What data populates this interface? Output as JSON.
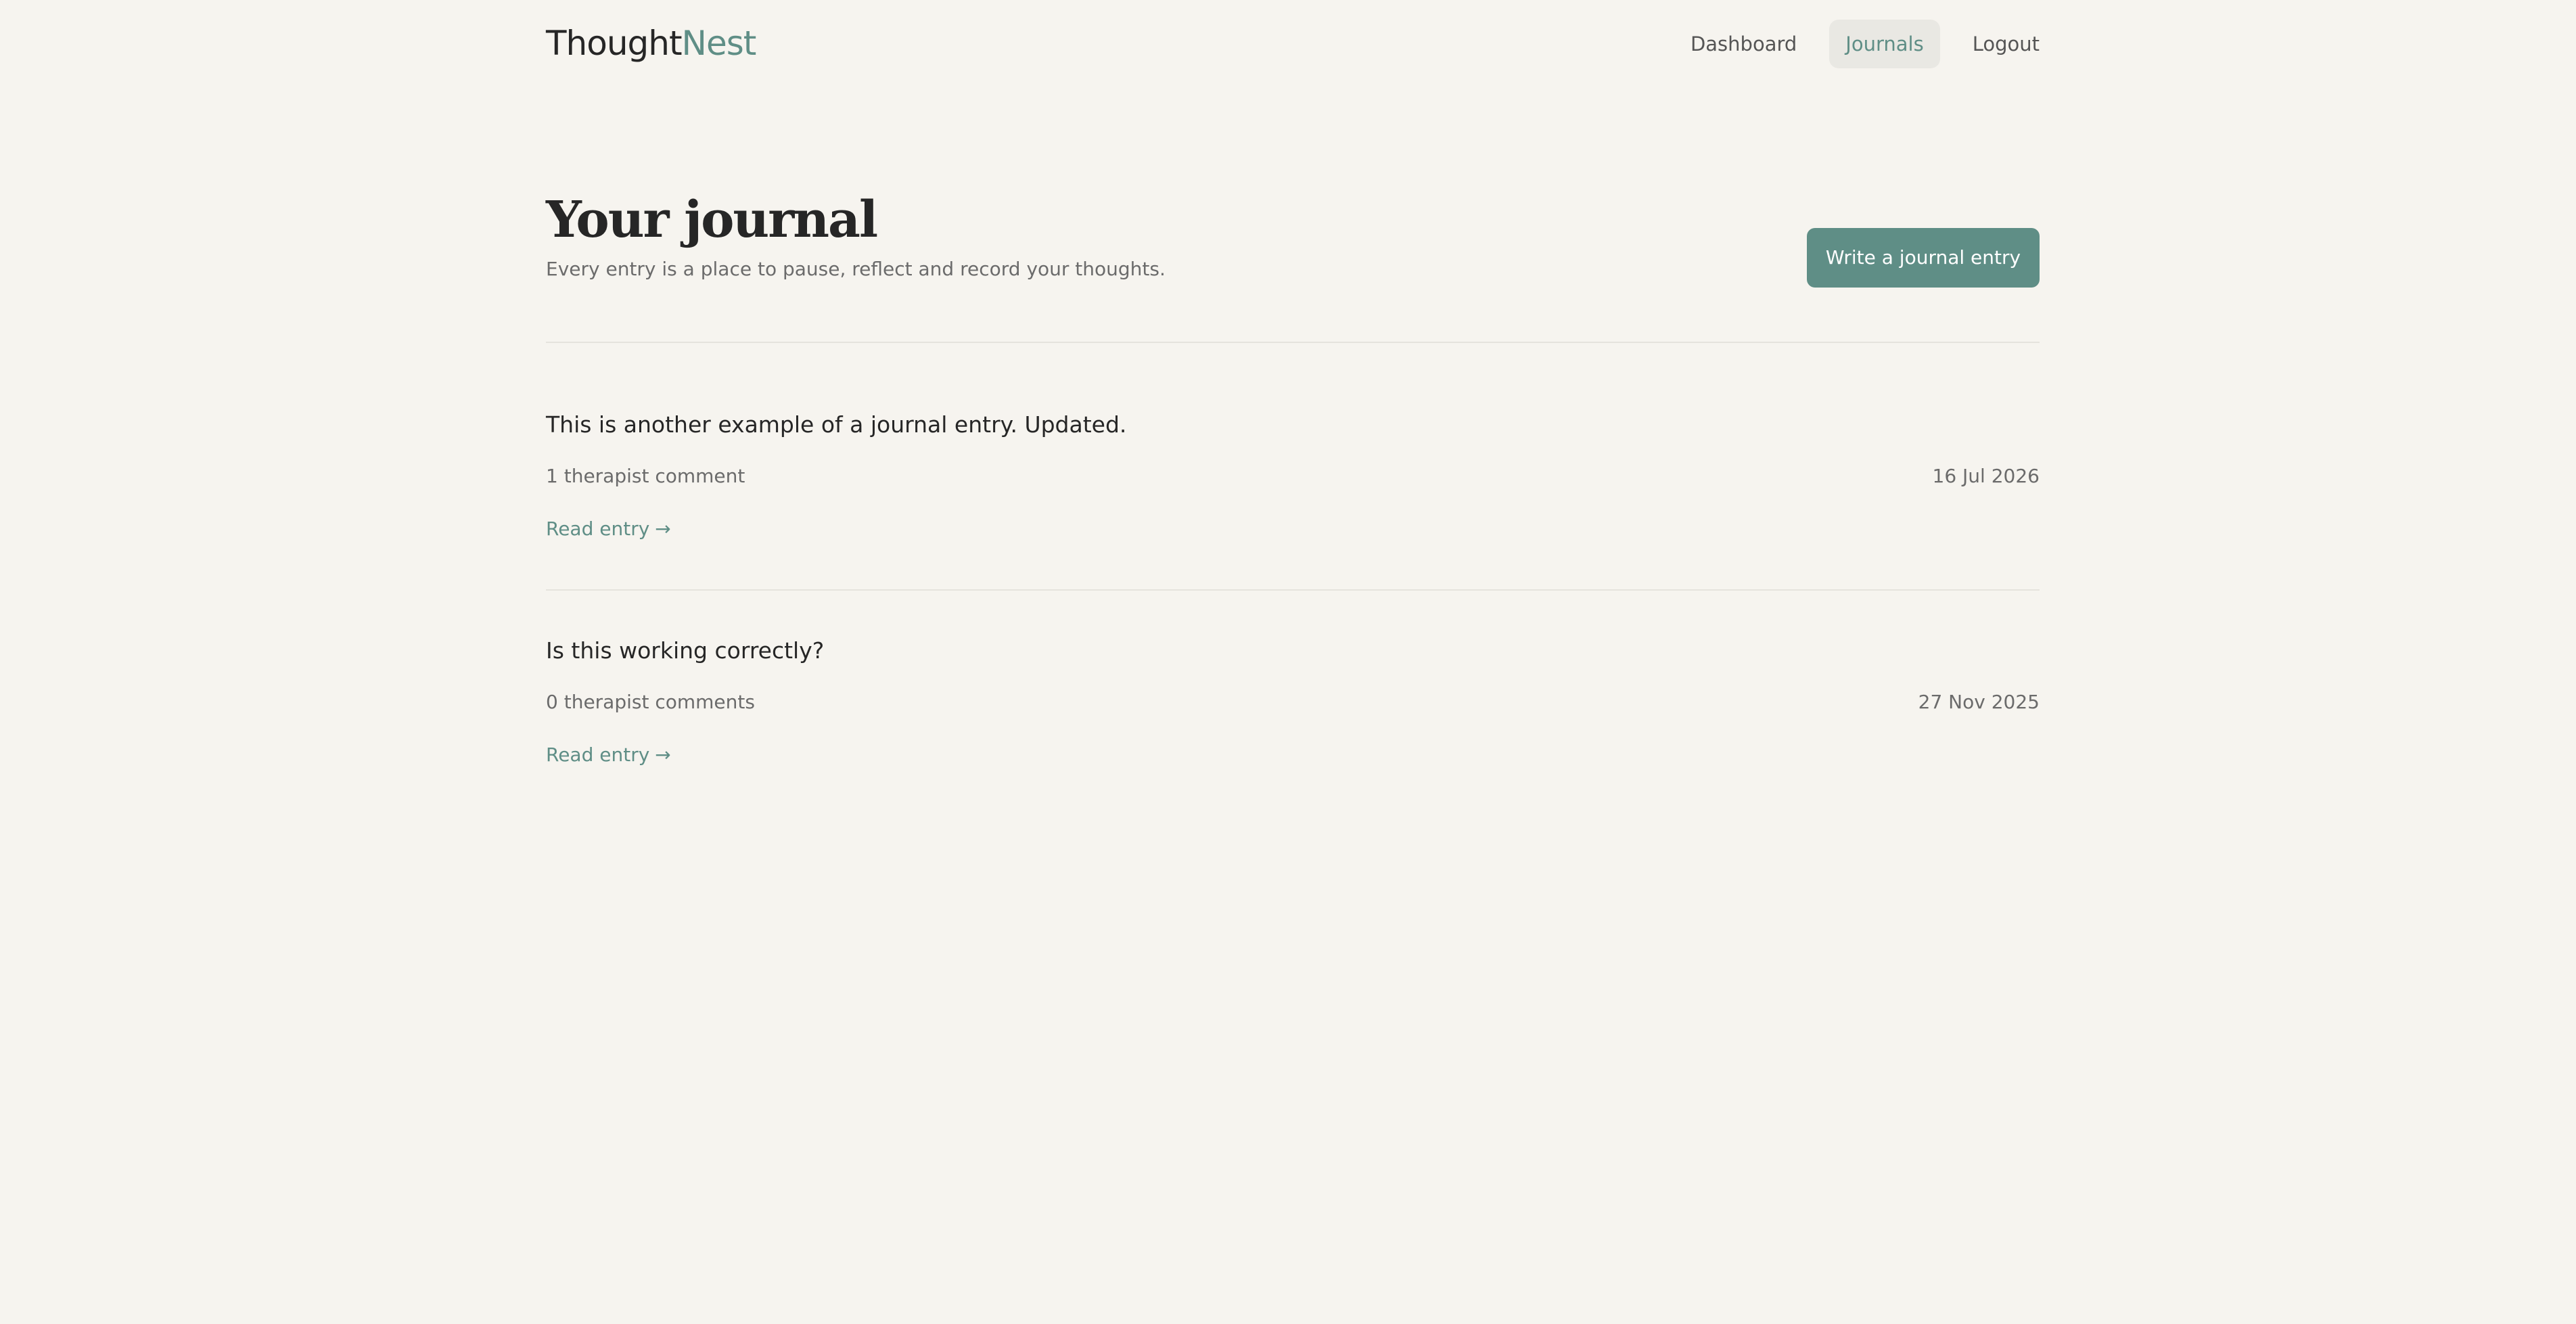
{
  "brand": {
    "part1": "Thought",
    "part2": "Nest"
  },
  "nav": {
    "dashboard": "Dashboard",
    "journals": "Journals",
    "logout": "Logout",
    "active": "journals"
  },
  "page": {
    "title": "Your journal",
    "subtitle": "Every entry is a place to pause, reflect and record your thoughts.",
    "write_button": "Write a journal entry"
  },
  "entries": [
    {
      "title": "This is another example of a journal entry. Updated.",
      "comments": "1 therapist comment",
      "date": "16 Jul 2026",
      "link": "Read entry"
    },
    {
      "title": "Is this working correctly?",
      "comments": "0 therapist comments",
      "date": "27 Nov 2025",
      "link": "Read entry"
    }
  ],
  "icons": {
    "arrow": "→"
  },
  "colors": {
    "background": "#f6f4ef",
    "accent": "#5f8e86",
    "text": "#262626",
    "muted": "#6b6b6b",
    "active_nav_bg": "#e9e8e3"
  }
}
